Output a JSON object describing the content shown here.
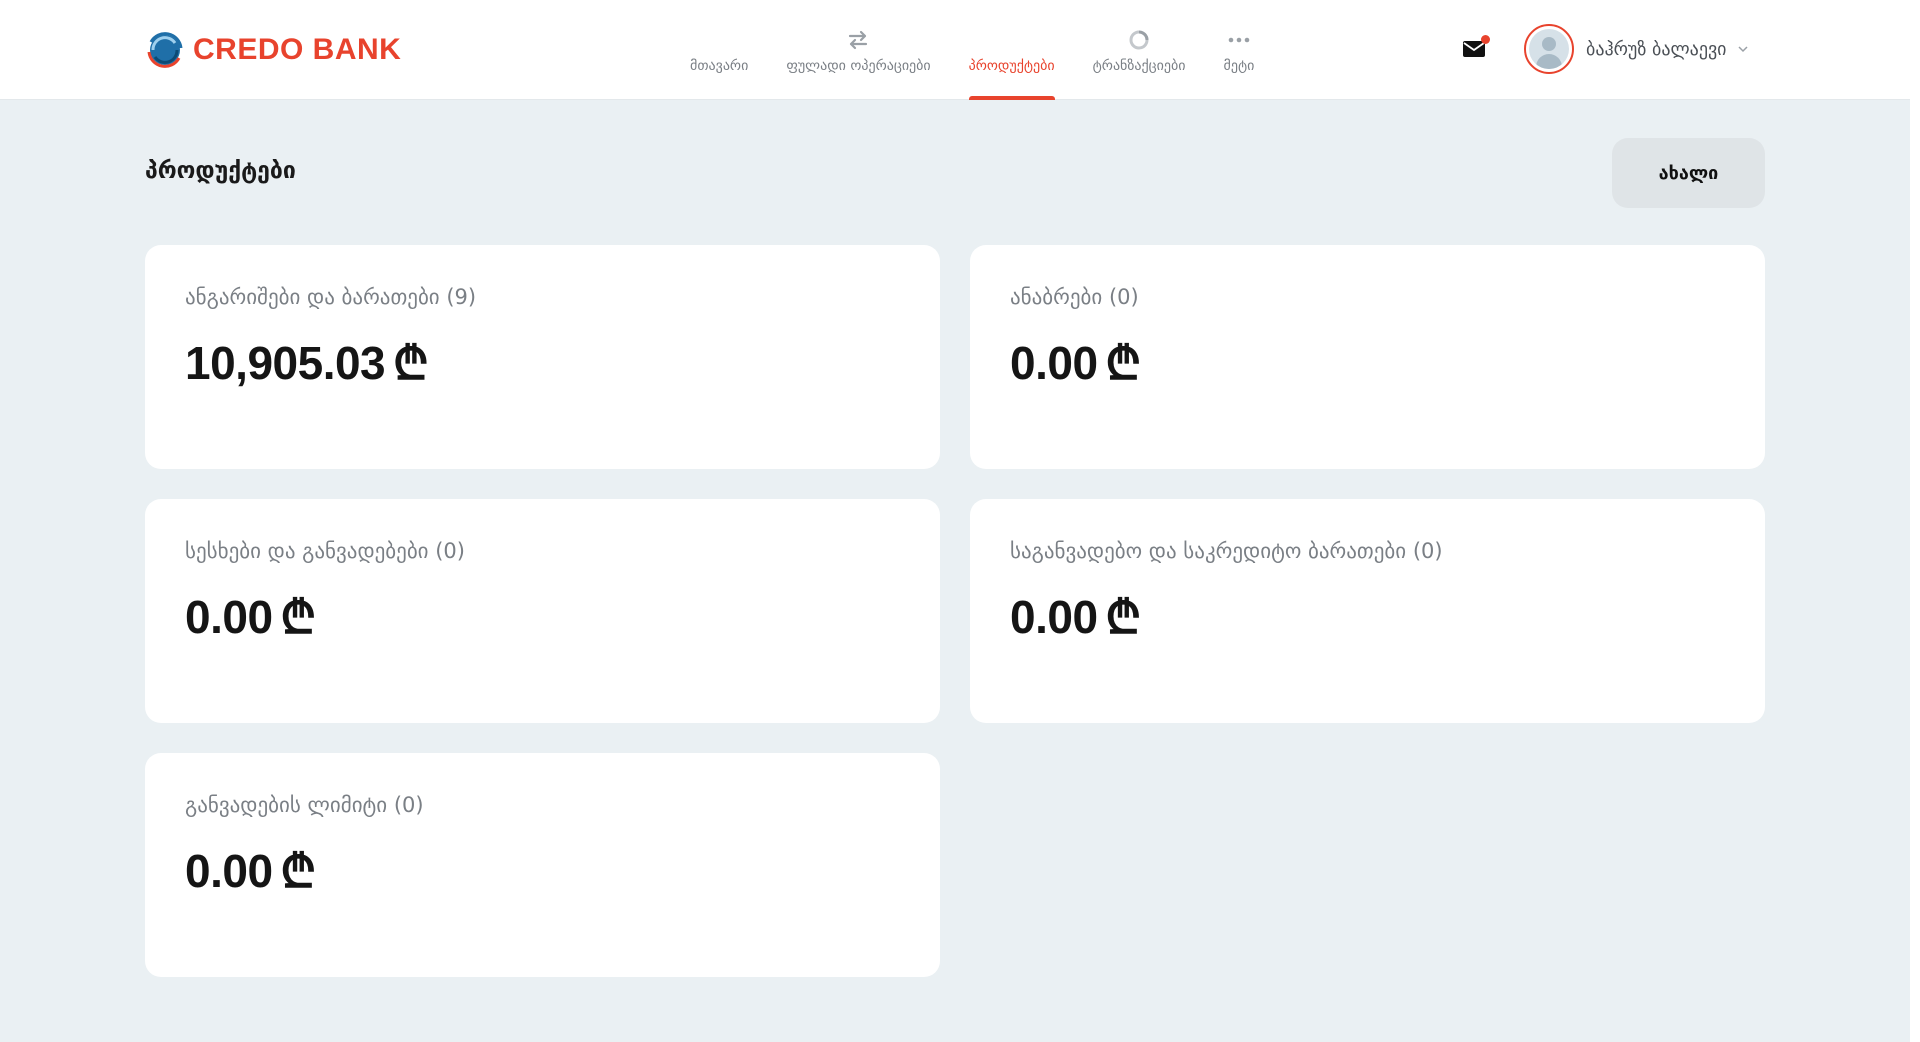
{
  "brand": {
    "name": "CREDO BANK",
    "accent": "#e8432d"
  },
  "nav": {
    "items": [
      {
        "label": "მთავარი",
        "icon": "home-icon",
        "active": false
      },
      {
        "label": "ფულადი ოპერაციები",
        "icon": "transfer-arrows-icon",
        "active": false
      },
      {
        "label": "პროდუქტები",
        "icon": "products-icon",
        "active": true
      },
      {
        "label": "ტრანზაქციები",
        "icon": "transactions-icon",
        "active": false
      },
      {
        "label": "მეტი",
        "icon": "more-dots-icon",
        "active": false
      }
    ]
  },
  "header": {
    "mail_icon": "mail-icon",
    "has_notification": true,
    "user_name": "ბაჰრუზ ბალაევი"
  },
  "page": {
    "title": "პროდუქტები",
    "new_button_label": "ახალი"
  },
  "cards": [
    {
      "title": "ანგარიშები და ბარათები (9)",
      "amount": "10,905.03",
      "currency": "₾"
    },
    {
      "title": "ანაბრები (0)",
      "amount": "0.00",
      "currency": "₾"
    },
    {
      "title": "სესხები და განვადებები (0)",
      "amount": "0.00",
      "currency": "₾"
    },
    {
      "title": "საგანვადებო და საკრედიტო ბარათები (0)",
      "amount": "0.00",
      "currency": "₾"
    },
    {
      "title": "განვადების ლიმიტი (0)",
      "amount": "0.00",
      "currency": "₾"
    }
  ]
}
